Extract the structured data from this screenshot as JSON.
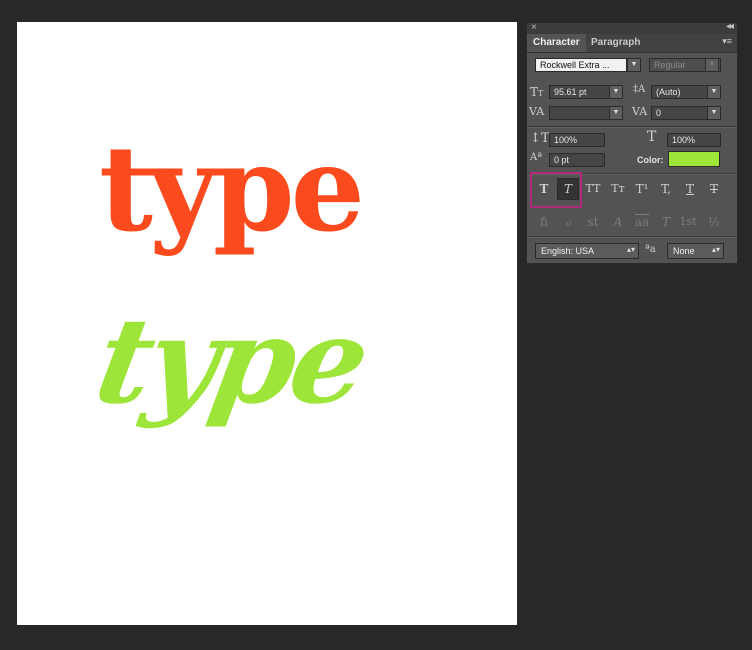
{
  "canvas": {
    "text_top": "type",
    "text_bottom": "type",
    "colors": {
      "top": "#fb4a1e",
      "bottom": "#9ee53a"
    }
  },
  "panel": {
    "titlebar": {
      "close_glyph": "×",
      "collapse_glyph": "◂◂"
    },
    "tabs": [
      {
        "label": "Character",
        "active": true
      },
      {
        "label": "Paragraph",
        "active": false
      }
    ],
    "menu_icon": "▾≡",
    "font_family": "Rockwell Extra ...",
    "font_style": "Regular",
    "font_size": "95.61 pt",
    "leading": "(Auto)",
    "kerning": "",
    "tracking": "0",
    "vertical_scale": "100%",
    "horizontal_scale": "100%",
    "baseline_shift": "0 pt",
    "color_label": "Color:",
    "color_value": "#9ee53a",
    "style_buttons": [
      "T",
      "T",
      "TT",
      "Tт",
      "T¹",
      "T,",
      "T",
      "T"
    ],
    "opentype_buttons": [
      "ﬁ",
      "ℴ",
      "st",
      "A",
      "aa",
      "T",
      "1st",
      "½"
    ],
    "language": "English: USA",
    "aa_glyph": "ªa",
    "antialias": "None",
    "icons": {
      "font_size": "font-size-icon",
      "leading": "leading-icon",
      "kerning": "kerning-icon",
      "tracking": "tracking-icon",
      "vscale": "vertical-scale-icon",
      "hscale": "horizontal-scale-icon",
      "baseline": "baseline-shift-icon"
    }
  }
}
